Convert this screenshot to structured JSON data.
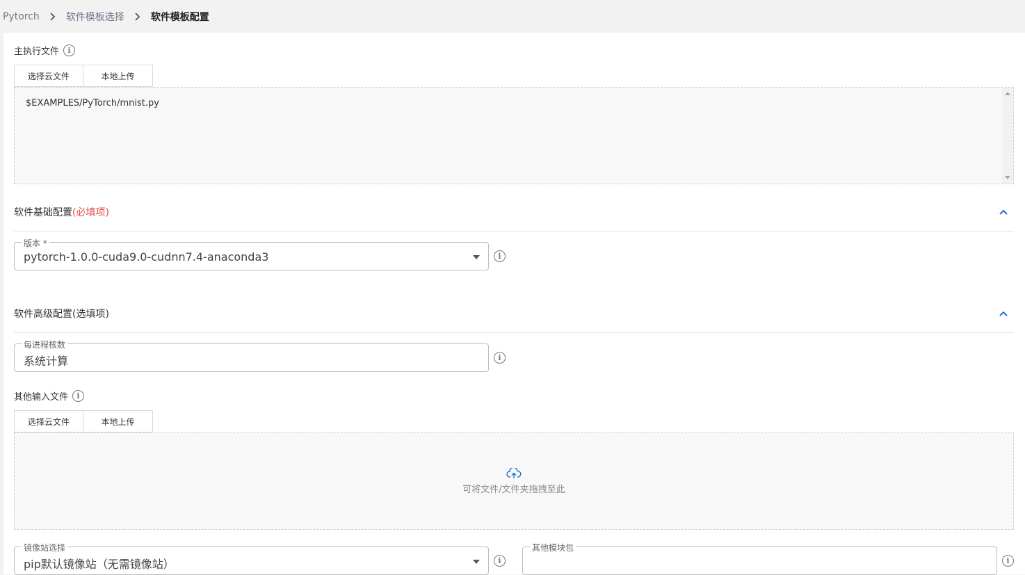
{
  "breadcrumb": {
    "items": [
      "Pytorch",
      "软件模板选择",
      "软件模板配置"
    ]
  },
  "main_file": {
    "label": "主执行文件",
    "buttons": {
      "cloud": "选择云文件",
      "local": "本地上传"
    },
    "value": "$EXAMPLES/PyTorch/mnist.py"
  },
  "basic_config": {
    "title": "软件基础配置",
    "required_note": "(必填项)",
    "version": {
      "legend": "版本 *",
      "value": "pytorch-1.0.0-cuda9.0-cudnn7.4-anaconda3"
    }
  },
  "advanced_config": {
    "title": "软件高级配置(选填项)",
    "cores": {
      "legend": "每进程核数",
      "value": "系统计算"
    },
    "other_files": {
      "label": "其他输入文件",
      "buttons": {
        "cloud": "选择云文件",
        "local": "本地上传"
      },
      "drop_hint": "可将文件/文件夹拖拽至此"
    },
    "mirror": {
      "legend": "镜像站选择",
      "value": "pip默认镜像站（无需镜像站）"
    },
    "modules": {
      "legend": "其他模块包",
      "value": ""
    }
  },
  "colors": {
    "accent": "#1e6fd9",
    "required": "#e04a4a"
  },
  "icons": {
    "info": "info-icon",
    "chevron_right": "chevron-right-icon",
    "chevron_up": "chevron-up-icon",
    "dropdown": "caret-down-icon",
    "upload": "cloud-upload-icon"
  }
}
